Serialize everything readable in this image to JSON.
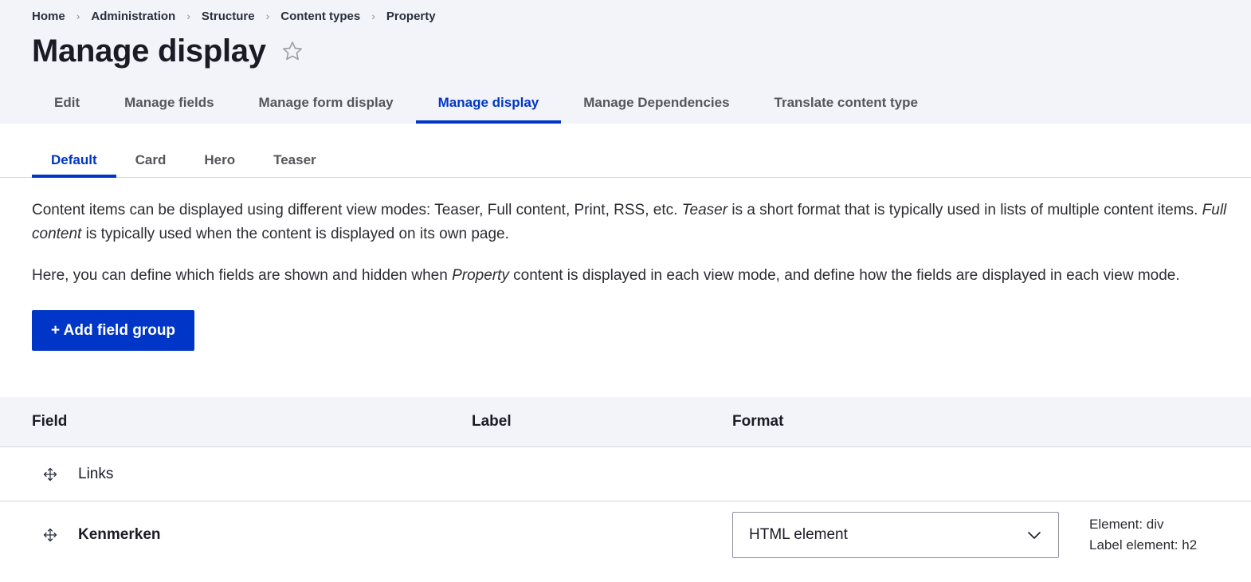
{
  "breadcrumb": {
    "separator": "›",
    "items": [
      {
        "label": "Home"
      },
      {
        "label": "Administration"
      },
      {
        "label": "Structure"
      },
      {
        "label": "Content types"
      },
      {
        "label": "Property"
      }
    ]
  },
  "header": {
    "title": "Manage display",
    "star_icon": "star-outline-icon"
  },
  "primary_tabs": [
    {
      "label": "Edit",
      "active": false
    },
    {
      "label": "Manage fields",
      "active": false
    },
    {
      "label": "Manage form display",
      "active": false
    },
    {
      "label": "Manage display",
      "active": true
    },
    {
      "label": "Manage Dependencies",
      "active": false
    },
    {
      "label": "Translate content type",
      "active": false
    }
  ],
  "secondary_tabs": [
    {
      "label": "Default",
      "active": true
    },
    {
      "label": "Card",
      "active": false
    },
    {
      "label": "Hero",
      "active": false
    },
    {
      "label": "Teaser",
      "active": false
    }
  ],
  "description": {
    "p1_part1": "Content items can be displayed using different view modes: Teaser, Full content, Print, RSS, etc. ",
    "p1_em": "Teaser",
    "p1_part2": " is a short format that is typically used in lists of multiple content items. ",
    "p1_em2": "Full content",
    "p1_part3": " is typically used when the content is displayed on its own page.",
    "p2_part1": "Here, you can define which fields are shown and hidden when ",
    "p2_em": "Property",
    "p2_part2": " content is displayed in each view mode, and define how the fields are displayed in each view mode."
  },
  "actions": {
    "add_field_group_label": "+ Add field group"
  },
  "table": {
    "columns": [
      {
        "key": "field",
        "label": "Field"
      },
      {
        "key": "label",
        "label": "Label"
      },
      {
        "key": "format",
        "label": "Format"
      },
      {
        "key": "summary",
        "label": ""
      }
    ],
    "rows": [
      {
        "drag_icon": "drag-move-icon",
        "field": "Links",
        "bold": false,
        "label": "",
        "format": "",
        "summary_lines": []
      },
      {
        "drag_icon": "drag-move-icon",
        "field": "Kenmerken",
        "bold": true,
        "label": "",
        "format": "HTML element",
        "format_chevron": "chevron-down-icon",
        "summary_lines": [
          "Element: div",
          "Label element: h2"
        ]
      }
    ]
  },
  "colors": {
    "accent": "#0036c7",
    "header_bg": "#f3f4f9",
    "text": "#1b1b25",
    "muted_text": "#55565b",
    "border": "#d3d4d9"
  }
}
